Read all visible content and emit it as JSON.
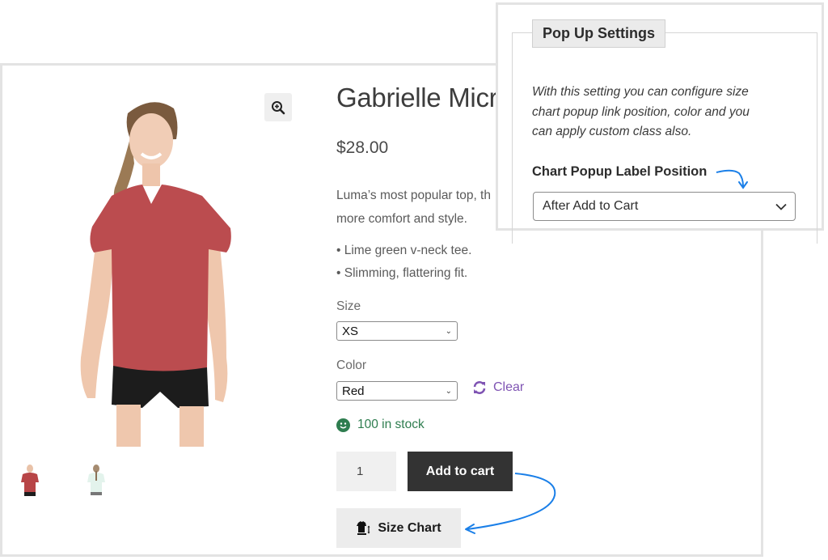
{
  "product": {
    "title": "Gabrielle Micro",
    "price": "$28.00",
    "description_lines": [
      "Luma’s most popular top, th",
      "more comfort and style."
    ],
    "bullets": [
      "• Lime green v-neck tee.",
      "• Slimming, flattering fit."
    ],
    "zoom_icon": "zoom-in-icon",
    "thumbnails": [
      "front-view",
      "back-view"
    ]
  },
  "variations": {
    "size_label": "Size",
    "size_value": "XS",
    "color_label": "Color",
    "color_value": "Red",
    "clear_label": "Clear"
  },
  "stock": {
    "text": "100 in stock"
  },
  "cart": {
    "quantity": "1",
    "add_to_cart_label": "Add to cart",
    "size_chart_label": "Size Chart"
  },
  "settings_panel": {
    "legend": "Pop Up Settings",
    "help_lines": [
      "With this setting you can configure size",
      "chart popup link position, color and you",
      "can apply custom class also."
    ],
    "position_label": "Chart Popup Label Position",
    "position_value": "After Add to Cart"
  },
  "colors": {
    "accent_purple": "#7f54b3",
    "stock_green": "#2e7d4f",
    "arrow_blue": "#1a7fe8",
    "button_dark": "#333333"
  }
}
